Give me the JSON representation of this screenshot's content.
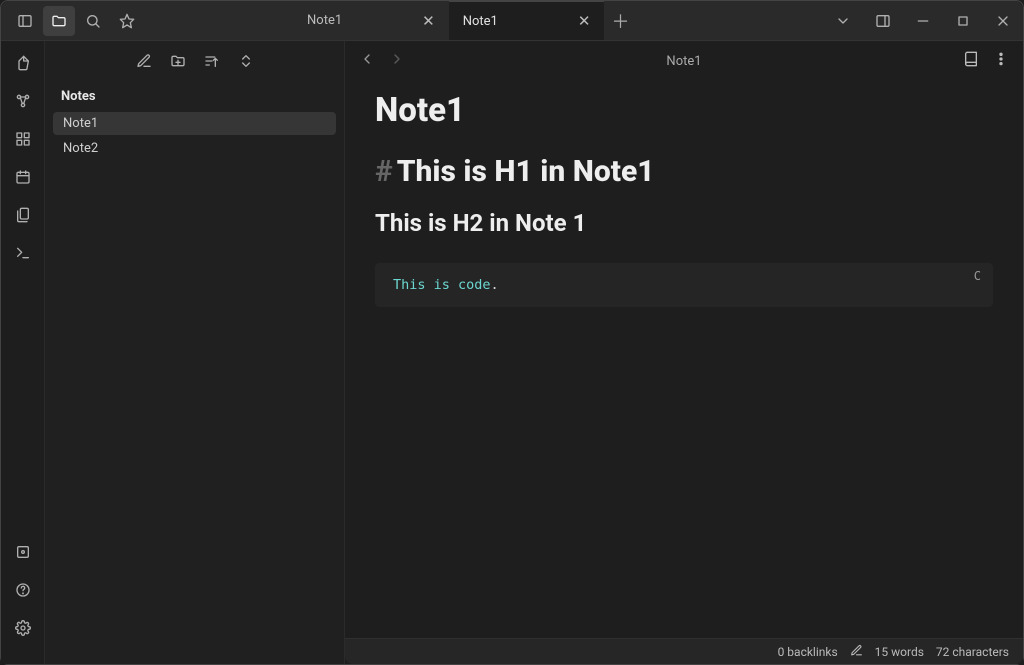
{
  "titlebar": {
    "tabs": [
      {
        "label": "Note1",
        "active": false
      },
      {
        "label": "Note1",
        "active": true
      }
    ]
  },
  "sidebar": {
    "vault_title": "Notes",
    "files": [
      {
        "name": "Note1",
        "active": true
      },
      {
        "name": "Note2",
        "active": false
      }
    ]
  },
  "main": {
    "header_title": "Note1",
    "note_title": "Note1",
    "h1_hash": "#",
    "h1_text": "This is H1 in Note1",
    "h2_text": "This is H2 in Note 1",
    "code_text": "This is code",
    "code_dot": ".",
    "code_lang": "C"
  },
  "status": {
    "backlinks": "0 backlinks",
    "words": "15 words",
    "chars": "72 characters"
  }
}
